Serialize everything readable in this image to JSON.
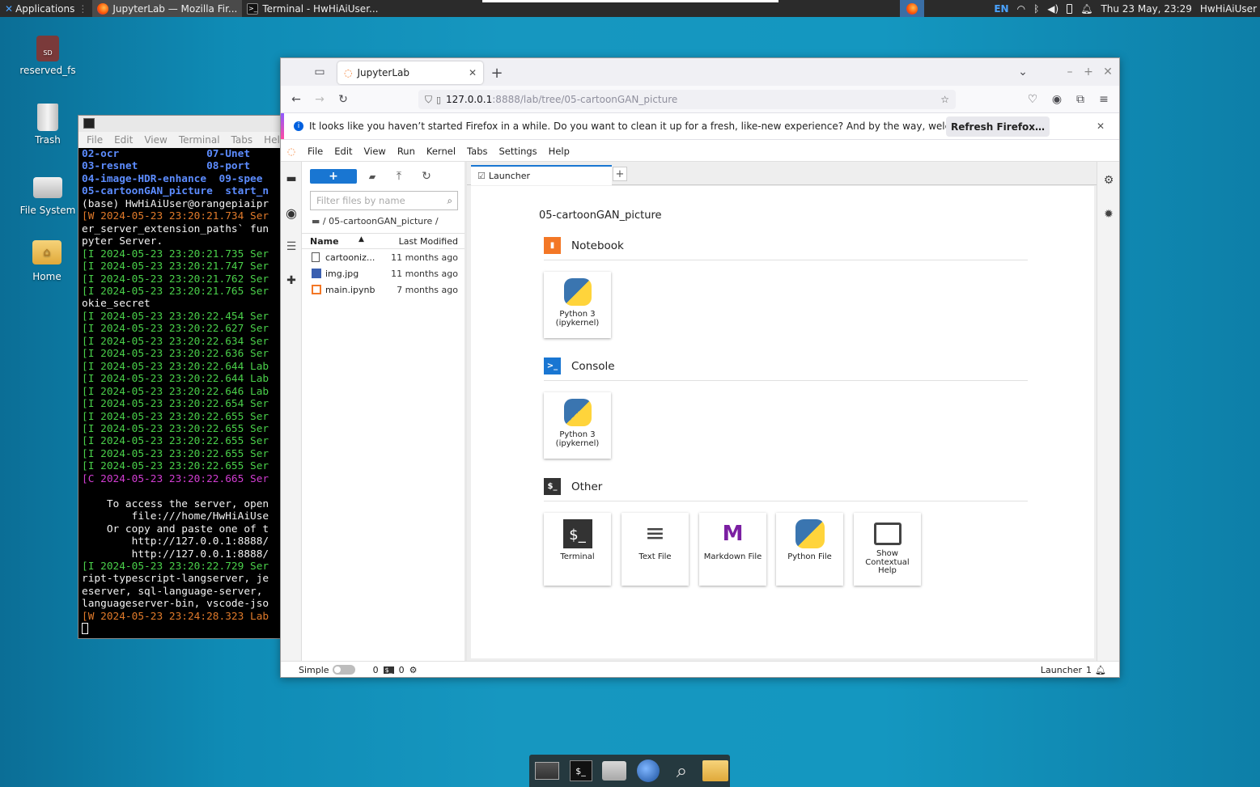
{
  "top_panel": {
    "apps_label": "Applications",
    "tasks": [
      {
        "label": "JupyterLab — Mozilla Fir..."
      },
      {
        "label": "Terminal - HwHiAiUser..."
      }
    ],
    "lang": "EN",
    "clock": "Thu 23 May, 23:29",
    "user": "HwHiAiUser"
  },
  "desktop": {
    "icons": [
      {
        "label": "reserved_fs"
      },
      {
        "label": "Trash"
      },
      {
        "label": "File System"
      },
      {
        "label": "Home"
      }
    ]
  },
  "terminal": {
    "menu": [
      "File",
      "Edit",
      "View",
      "Terminal",
      "Tabs",
      "Help"
    ],
    "lines": [
      {
        "text": "02-ocr              07-Unet",
        "cls": "t-blue"
      },
      {
        "text": "03-resnet           08-port",
        "cls": "t-blue"
      },
      {
        "text": "04-image-HDR-enhance  09-spee",
        "cls": "t-blue"
      },
      {
        "text": "05-cartoonGAN_picture  start_n",
        "cls": "t-blue"
      },
      {
        "text": "(base) HwHiAiUser@orangepiaipr",
        "cls": "t-white"
      },
      {
        "text": "[W 2024-05-23 23:20:21.734 Ser",
        "cls": "t-orange"
      },
      {
        "text": "er_server_extension_paths` fun",
        "cls": "t-white"
      },
      {
        "text": "pyter Server.",
        "cls": "t-white"
      },
      {
        "text": "[I 2024-05-23 23:20:21.735 Ser",
        "cls": "t-green"
      },
      {
        "text": "[I 2024-05-23 23:20:21.747 Ser",
        "cls": "t-green"
      },
      {
        "text": "[I 2024-05-23 23:20:21.762 Ser",
        "cls": "t-green"
      },
      {
        "text": "[I 2024-05-23 23:20:21.765 Ser",
        "cls": "t-green"
      },
      {
        "text": "okie_secret",
        "cls": "t-white"
      },
      {
        "text": "[I 2024-05-23 23:20:22.454 Ser",
        "cls": "t-green"
      },
      {
        "text": "[I 2024-05-23 23:20:22.627 Ser",
        "cls": "t-green"
      },
      {
        "text": "[I 2024-05-23 23:20:22.634 Ser",
        "cls": "t-green"
      },
      {
        "text": "[I 2024-05-23 23:20:22.636 Ser",
        "cls": "t-green"
      },
      {
        "text": "[I 2024-05-23 23:20:22.644 Lab",
        "cls": "t-green"
      },
      {
        "text": "[I 2024-05-23 23:20:22.644 Lab",
        "cls": "t-green"
      },
      {
        "text": "[I 2024-05-23 23:20:22.646 Lab",
        "cls": "t-green"
      },
      {
        "text": "[I 2024-05-23 23:20:22.654 Ser",
        "cls": "t-green"
      },
      {
        "text": "[I 2024-05-23 23:20:22.655 Ser",
        "cls": "t-green"
      },
      {
        "text": "[I 2024-05-23 23:20:22.655 Ser",
        "cls": "t-green"
      },
      {
        "text": "[I 2024-05-23 23:20:22.655 Ser",
        "cls": "t-green"
      },
      {
        "text": "[I 2024-05-23 23:20:22.655 Ser",
        "cls": "t-green"
      },
      {
        "text": "[I 2024-05-23 23:20:22.655 Ser",
        "cls": "t-green"
      },
      {
        "text": "[C 2024-05-23 23:20:22.665 Ser",
        "cls": "t-magenta"
      },
      {
        "text": "",
        "cls": "t-white"
      },
      {
        "text": "    To access the server, open",
        "cls": "t-white"
      },
      {
        "text": "        file:///home/HwHiAiUse",
        "cls": "t-white"
      },
      {
        "text": "    Or copy and paste one of t",
        "cls": "t-white"
      },
      {
        "text": "        http://127.0.0.1:8888/",
        "cls": "t-white"
      },
      {
        "text": "        http://127.0.0.1:8888/",
        "cls": "t-white"
      },
      {
        "text": "[I 2024-05-23 23:20:22.729 Ser",
        "cls": "t-green"
      },
      {
        "text": "ript-typescript-langserver, je",
        "cls": "t-white"
      },
      {
        "text": "eserver, sql-language-server, ",
        "cls": "t-white"
      },
      {
        "text": "languageserver-bin, vscode-jso",
        "cls": "t-white"
      },
      {
        "text": "[W 2024-05-23 23:24:28.323 Lab",
        "cls": "t-orange"
      }
    ]
  },
  "firefox": {
    "tab_title": "JupyterLab",
    "url_host": "127.0.0.1",
    "url_rest": ":8888/lab/tree/05-cartoonGAN_picture",
    "notice": "It looks like you haven’t started Firefox in a while. Do you want to clean it up for a fresh, like-new experience? And by the way, welcome back!",
    "refresh_label": "Refresh Firefox…"
  },
  "jupyter": {
    "menu": [
      "File",
      "Edit",
      "View",
      "Run",
      "Kernel",
      "Tabs",
      "Settings",
      "Help"
    ],
    "filter_placeholder": "Filter files by name",
    "breadcrumb": "/ 05-cartoonGAN_picture /",
    "col_name": "Name",
    "col_modified": "Last Modified",
    "files": [
      {
        "name": "cartooniz...",
        "modified": "11 months ago",
        "type": "file"
      },
      {
        "name": "img.jpg",
        "modified": "11 months ago",
        "type": "image"
      },
      {
        "name": "main.ipynb",
        "modified": "7 months ago",
        "type": "notebook"
      }
    ],
    "tab_label": "Launcher",
    "launcher": {
      "cwd": "05-cartoonGAN_picture",
      "notebook_title": "Notebook",
      "console_title": "Console",
      "other_title": "Other",
      "notebook_card": "Python 3 (ipykernel)",
      "console_card": "Python 3 (ipykernel)",
      "other_cards": [
        "Terminal",
        "Text File",
        "Markdown File",
        "Python File",
        "Show Contextual Help"
      ]
    },
    "status": {
      "mode": "Simple",
      "kernels": "0",
      "terminals": "0",
      "right_label": "Launcher",
      "notifications": "1"
    }
  },
  "colors": {
    "accent": "#1976d2",
    "jupyter_orange": "#f37726",
    "desktop_bg": "#1497c0"
  }
}
